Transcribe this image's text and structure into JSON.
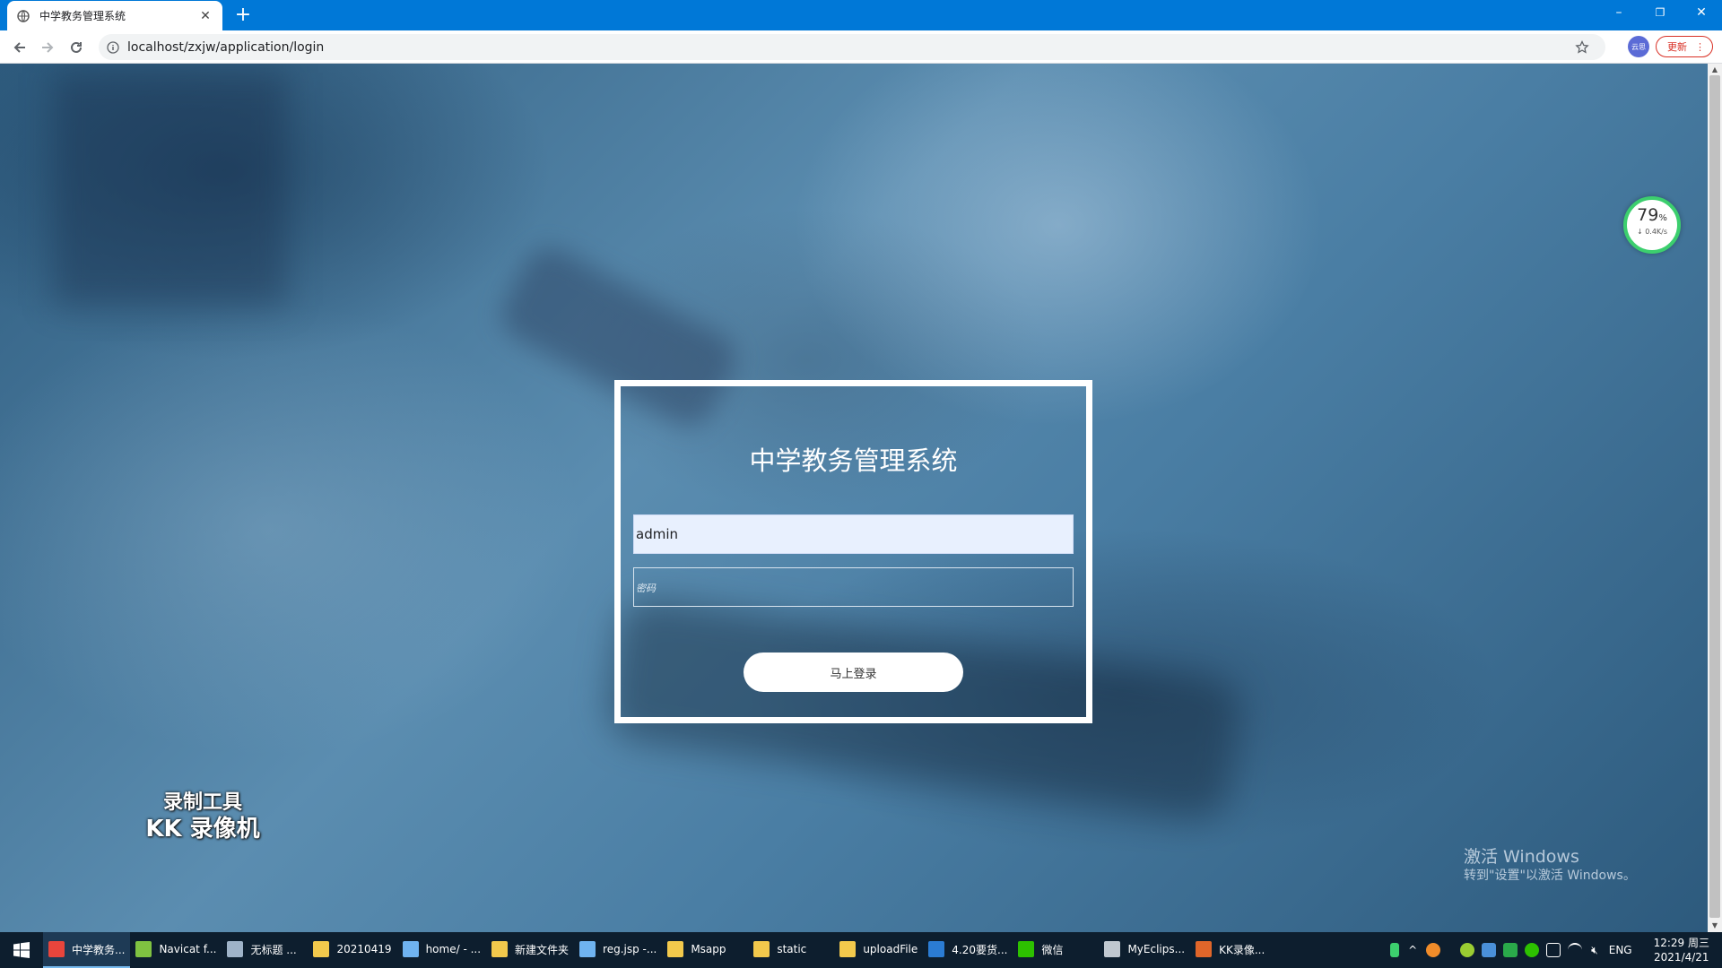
{
  "browser": {
    "tab_title": "中学教务管理系统",
    "tab_close": "✕",
    "new_tab": "+",
    "url": "localhost/zxjw/application/login",
    "profile_label": "云思",
    "update_label": "更新",
    "update_menu": "⋮",
    "window_minimize": "–",
    "window_restore": "❐",
    "window_close": "✕"
  },
  "login": {
    "title": "中学教务管理系统",
    "username_value": "admin",
    "password_placeholder": "密码",
    "submit_label": "马上登录"
  },
  "speed_widget": {
    "percent": "79",
    "percent_unit": "%",
    "rate": "↓ 0.4K/s"
  },
  "watermark": {
    "line1": "录制工具",
    "line2": "KK 录像机"
  },
  "activation": {
    "line1": "激活 Windows",
    "line2": "转到\"设置\"以激活 Windows。"
  },
  "taskbar": {
    "items": [
      {
        "label": "中学教务...",
        "color": "#e8453c"
      },
      {
        "label": "Navicat f...",
        "color": "#7fc241"
      },
      {
        "label": "无标题 ...",
        "color": "#9fb3c8"
      },
      {
        "label": "20210419",
        "color": "#f2c94c"
      },
      {
        "label": "home/ - ...",
        "color": "#6fb3f0"
      },
      {
        "label": "新建文件夹",
        "color": "#f2c94c"
      },
      {
        "label": "reg.jsp -...",
        "color": "#6fb3f0"
      },
      {
        "label": "Msapp",
        "color": "#f2c94c"
      },
      {
        "label": "static",
        "color": "#f2c94c"
      },
      {
        "label": "uploadFile",
        "color": "#f2c94c"
      },
      {
        "label": "4.20要货...",
        "color": "#2b7cd3"
      },
      {
        "label": "微信",
        "color": "#2dc100"
      },
      {
        "label": "MyEclips...",
        "color": "#c0c8d0"
      },
      {
        "label": "KK录像...",
        "color": "#e0662a"
      }
    ],
    "language": "ENG",
    "time": "12:29 周三",
    "date": "2021/4/21"
  }
}
